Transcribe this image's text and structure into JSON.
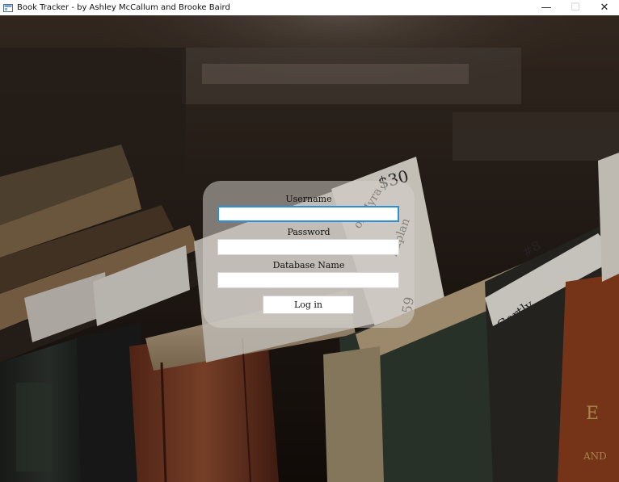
{
  "window": {
    "title": "Book Tracker - by Ashley McCallum and Brooke Baird",
    "app_icon": "book-tracker-app-icon",
    "controls": {
      "minimize_glyph": "—",
      "maximize_glyph": "☐",
      "close_glyph": "✕"
    }
  },
  "background": {
    "description_icon": "old-books-photo",
    "accent_color": "#2d8fd5"
  },
  "login": {
    "username_label": "Username",
    "username_value": "",
    "password_label": "Password",
    "password_value": "",
    "database_label": "Database Name",
    "database_value": "",
    "login_button_label": "Log in"
  }
}
